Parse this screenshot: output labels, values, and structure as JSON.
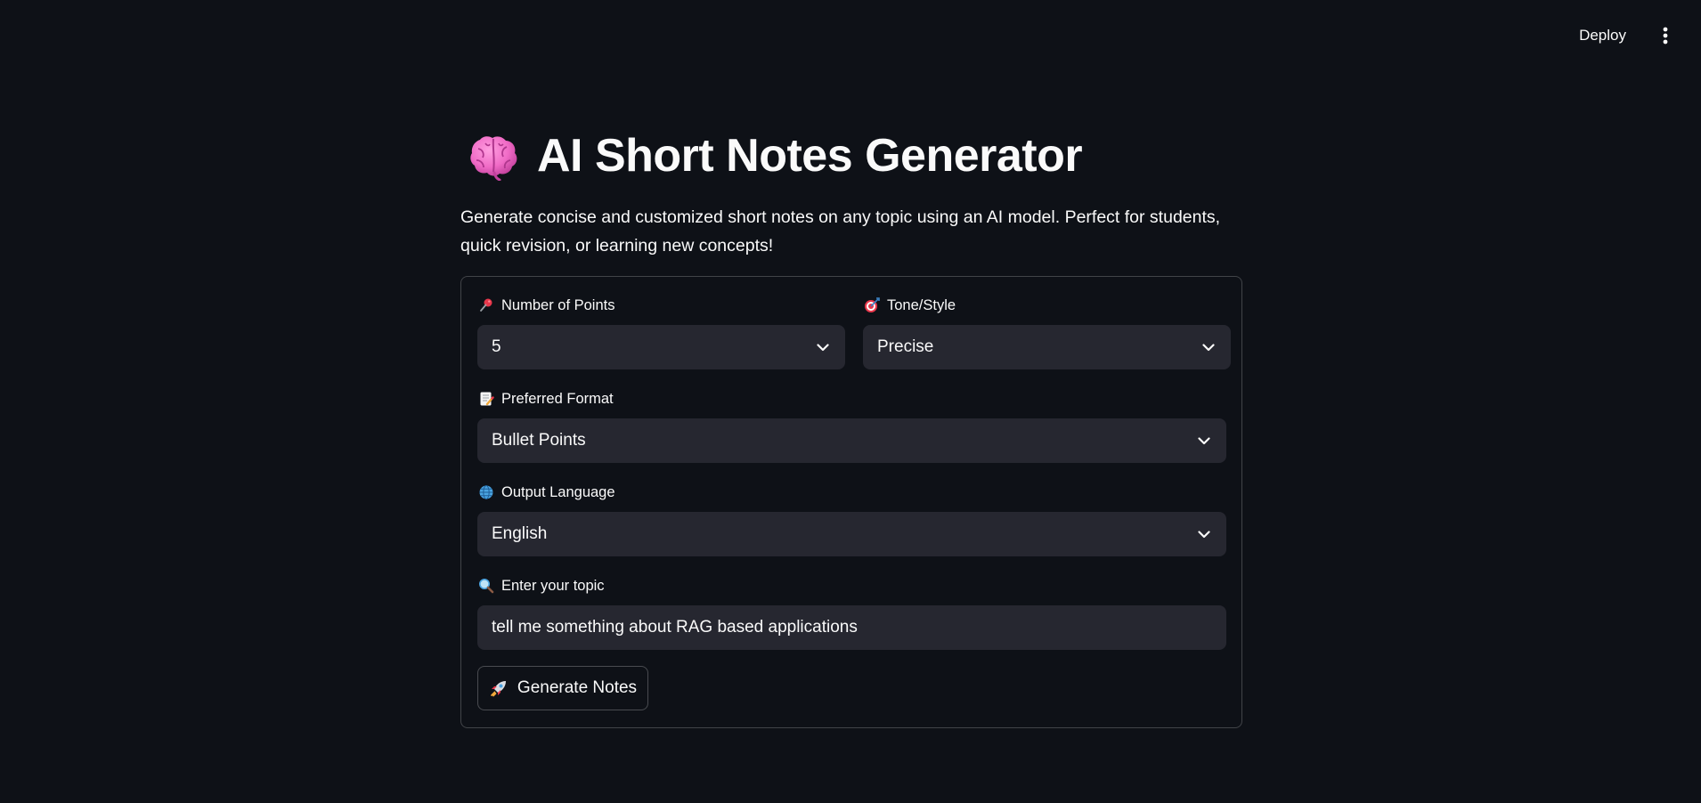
{
  "header": {
    "deploy_label": "Deploy",
    "menu_icon": "more-vertical-icon"
  },
  "page": {
    "title": "AI Short Notes Generator",
    "title_icon": "brain-icon",
    "description": "Generate concise and customized short notes on any topic using an AI model. Perfect for students, quick revision, or learning new concepts!"
  },
  "form": {
    "num_points": {
      "label": "Number of Points",
      "icon": "pushpin-icon",
      "value": "5"
    },
    "tone": {
      "label": "Tone/Style",
      "icon": "target-icon",
      "value": "Precise"
    },
    "format": {
      "label": "Preferred Format",
      "icon": "memo-icon",
      "value": "Bullet Points"
    },
    "language": {
      "label": "Output Language",
      "icon": "globe-icon",
      "value": "English"
    },
    "topic": {
      "label": "Enter your topic",
      "icon": "magnifier-icon",
      "value": "tell me something about RAG based applications"
    },
    "generate_button": {
      "label": "Generate Notes",
      "icon": "rocket-icon"
    }
  },
  "colors": {
    "background": "#0e1117",
    "input_background": "#262730",
    "text": "#fafafa",
    "brain_pink": "#f06bc6"
  }
}
